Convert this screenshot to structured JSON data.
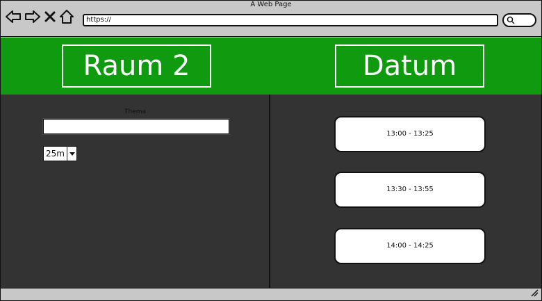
{
  "window": {
    "title": "A Web Page"
  },
  "browser": {
    "url": "https://",
    "icons": [
      "back-arrow-icon",
      "forward-arrow-icon",
      "close-x-icon",
      "home-icon",
      "search-icon"
    ]
  },
  "header": {
    "room": "Raum 2",
    "date": "Datum"
  },
  "form": {
    "theme_label": "Thema",
    "theme_value": "",
    "duration_value": "25m"
  },
  "slots": [
    {
      "label": "13:00 - 13:25"
    },
    {
      "label": "13:30 - 13:55"
    },
    {
      "label": "14:00 - 14:25"
    }
  ],
  "colors": {
    "header_green": "#0f9a0f",
    "content_dark": "#333333",
    "chrome_gray": "#c8c8c8"
  }
}
